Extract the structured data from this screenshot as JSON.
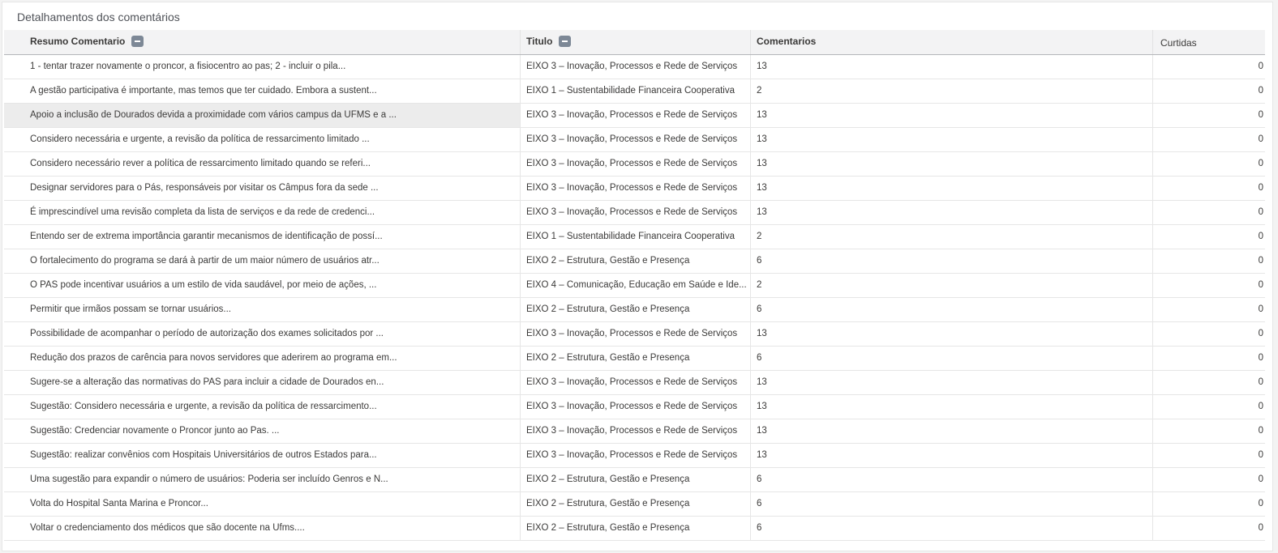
{
  "panel": {
    "title": "Detalhamentos dos comentários"
  },
  "table": {
    "columns": {
      "resumo": "Resumo Comentario",
      "titulo": "Titulo",
      "comentarios": "Comentarios",
      "curtidas": "Curtidas"
    },
    "rows": [
      {
        "resumo": "1 - tentar trazer novamente o proncor, a fisiocentro ao pas; 2 - incluir o pila...",
        "titulo": "EIXO 3 – Inovação, Processos e Rede de Serviços",
        "comentarios": "13",
        "curtidas": "0"
      },
      {
        "resumo": "A gestão participativa é importante, mas temos que ter cuidado. Embora a sustent...",
        "titulo": "EIXO 1 – Sustentabilidade Financeira Cooperativa",
        "comentarios": "2",
        "curtidas": "0"
      },
      {
        "resumo": "Apoio a inclusão de Dourados devida a proximidade com vários campus da UFMS e a ...",
        "titulo": "EIXO 3 – Inovação, Processos e Rede de Serviços",
        "comentarios": "13",
        "curtidas": "0"
      },
      {
        "resumo": "Considero necessária e urgente, a revisão da política de ressarcimento limitado ...",
        "titulo": "EIXO 3 – Inovação, Processos e Rede de Serviços",
        "comentarios": "13",
        "curtidas": "0"
      },
      {
        "resumo": "Considero necessário rever a política de ressarcimento limitado quando se referi...",
        "titulo": "EIXO 3 – Inovação, Processos e Rede de Serviços",
        "comentarios": "13",
        "curtidas": "0"
      },
      {
        "resumo": "Designar servidores para o Pás, responsáveis por visitar os Câmpus fora da sede ...",
        "titulo": "EIXO 3 – Inovação, Processos e Rede de Serviços",
        "comentarios": "13",
        "curtidas": "0"
      },
      {
        "resumo": "É imprescindível uma revisão completa da lista de serviços e da rede de credenci...",
        "titulo": "EIXO 3 – Inovação, Processos e Rede de Serviços",
        "comentarios": "13",
        "curtidas": "0"
      },
      {
        "resumo": "Entendo ser de extrema importância garantir mecanismos de identificação de possí...",
        "titulo": "EIXO 1 – Sustentabilidade Financeira Cooperativa",
        "comentarios": "2",
        "curtidas": "0"
      },
      {
        "resumo": "O fortalecimento do programa se dará à partir de um maior número de usuários atr...",
        "titulo": "EIXO 2 – Estrutura, Gestão e Presença",
        "comentarios": "6",
        "curtidas": "0"
      },
      {
        "resumo": "O PAS pode incentivar usuários a um estilo de vida saudável, por meio de ações, ...",
        "titulo": "EIXO 4 – Comunicação, Educação em Saúde e Ide...",
        "comentarios": "2",
        "curtidas": "0"
      },
      {
        "resumo": "Permitir que irmãos possam se tornar usuários...",
        "titulo": "EIXO 2 – Estrutura, Gestão e Presença",
        "comentarios": "6",
        "curtidas": "0"
      },
      {
        "resumo": "Possibilidade de acompanhar o período de autorização dos exames solicitados por ...",
        "titulo": "EIXO 3 – Inovação, Processos e Rede de Serviços",
        "comentarios": "13",
        "curtidas": "0"
      },
      {
        "resumo": "Redução dos prazos de carência para novos servidores que aderirem ao programa em...",
        "titulo": "EIXO 2 – Estrutura, Gestão e Presença",
        "comentarios": "6",
        "curtidas": "0"
      },
      {
        "resumo": "Sugere-se a alteração das normativas do PAS para incluir a cidade de Dourados en...",
        "titulo": "EIXO 3 – Inovação, Processos e Rede de Serviços",
        "comentarios": "13",
        "curtidas": "0"
      },
      {
        "resumo": "Sugestão: Considero necessária e urgente, a revisão da política de ressarcimento...",
        "titulo": "EIXO 3 – Inovação, Processos e Rede de Serviços",
        "comentarios": "13",
        "curtidas": "0"
      },
      {
        "resumo": "Sugestão: Credenciar novamente o Proncor junto ao Pas. ...",
        "titulo": "EIXO 3 – Inovação, Processos e Rede de Serviços",
        "comentarios": "13",
        "curtidas": "0"
      },
      {
        "resumo": "Sugestão: realizar convênios com Hospitais Universitários de outros Estados para...",
        "titulo": "EIXO 3 – Inovação, Processos e Rede de Serviços",
        "comentarios": "13",
        "curtidas": "0"
      },
      {
        "resumo": "Uma sugestão para expandir o número de usuários: Poderia ser incluído Genros e N...",
        "titulo": "EIXO 2 – Estrutura, Gestão e Presença",
        "comentarios": "6",
        "curtidas": "0"
      },
      {
        "resumo": "Volta do Hospital Santa Marina e Proncor...",
        "titulo": "EIXO 2 – Estrutura, Gestão e Presença",
        "comentarios": "6",
        "curtidas": "0"
      },
      {
        "resumo": "Voltar o credenciamento dos médicos que são docente na Ufms....",
        "titulo": "EIXO 2 – Estrutura, Gestão e Presença",
        "comentarios": "6",
        "curtidas": "0"
      }
    ]
  },
  "colors": {
    "header_bg": "#f3f3f4",
    "collapse_button": "#7d8896",
    "hover_row": "#ececec"
  }
}
